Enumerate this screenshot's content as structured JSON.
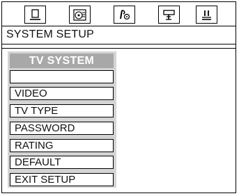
{
  "icon_bar": {
    "icons": [
      {
        "name": "general-setup-icon"
      },
      {
        "name": "audio-setup-icon"
      },
      {
        "name": "dolby-digital-icon"
      },
      {
        "name": "video-setup-icon"
      },
      {
        "name": "preference-icon"
      }
    ]
  },
  "header": {
    "title": "SYSTEM SETUP"
  },
  "menu": {
    "title": "TV SYSTEM",
    "selected_value": "",
    "items": [
      "VIDEO",
      "TV TYPE",
      "PASSWORD",
      "RATING",
      "DEFAULT",
      "EXIT SETUP"
    ]
  }
}
